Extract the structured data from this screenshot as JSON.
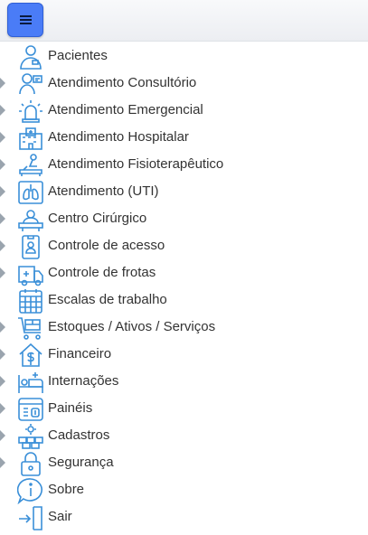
{
  "colors": {
    "accent": "#4a7cf7",
    "icon": "#3a8fd8",
    "caret": "#9aa4ae",
    "text": "#333333"
  },
  "topbar": {
    "menu_icon": "hamburger-icon"
  },
  "menu": {
    "items": [
      {
        "label": "Pacientes",
        "icon": "patient-icon",
        "expandable": false
      },
      {
        "label": "Atendimento Consultório",
        "icon": "doctor-consultation-icon",
        "expandable": true
      },
      {
        "label": "Atendimento Emergencial",
        "icon": "emergency-siren-icon",
        "expandable": true
      },
      {
        "label": "Atendimento Hospitalar",
        "icon": "hospital-building-icon",
        "expandable": true
      },
      {
        "label": "Atendimento Fisioterapêutico",
        "icon": "physiotherapy-icon",
        "expandable": true
      },
      {
        "label": "Atendimento (UTI)",
        "icon": "icu-lungs-icon",
        "expandable": true
      },
      {
        "label": "Centro Cirúrgico",
        "icon": "surgery-icon",
        "expandable": true
      },
      {
        "label": "Controle de acesso",
        "icon": "id-badge-icon",
        "expandable": true
      },
      {
        "label": "Controle de frotas",
        "icon": "ambulance-icon",
        "expandable": true
      },
      {
        "label": "Escalas de trabalho",
        "icon": "calendar-icon",
        "expandable": false
      },
      {
        "label": "Estoques / Ativos / Serviços",
        "icon": "stock-cart-icon",
        "expandable": true
      },
      {
        "label": "Financeiro",
        "icon": "finance-house-dollar-icon",
        "expandable": true
      },
      {
        "label": "Internações",
        "icon": "hospital-bed-icon",
        "expandable": true
      },
      {
        "label": "Painéis",
        "icon": "dashboard-panel-icon",
        "expandable": true
      },
      {
        "label": "Cadastros",
        "icon": "registrations-boxes-icon",
        "expandable": true
      },
      {
        "label": "Segurança",
        "icon": "lock-icon",
        "expandable": true
      },
      {
        "label": "Sobre",
        "icon": "info-icon",
        "expandable": false
      },
      {
        "label": "Sair",
        "icon": "exit-door-icon",
        "expandable": false
      }
    ]
  }
}
